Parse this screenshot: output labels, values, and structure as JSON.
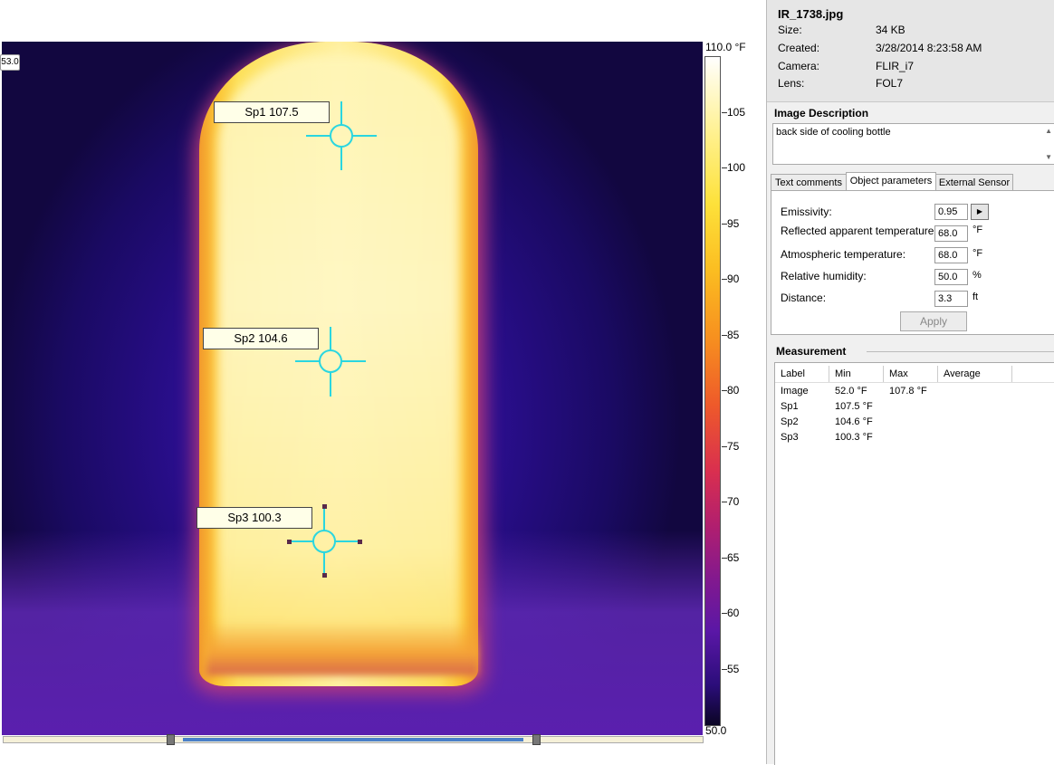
{
  "image": {
    "corner_value": "53.0",
    "spots": [
      {
        "label": "Sp1 107.5"
      },
      {
        "label": "Sp2 104.6"
      },
      {
        "label": "Sp3 100.3"
      }
    ]
  },
  "scale": {
    "max_label": "110.0 °F",
    "min_label": "50.0",
    "ticks": [
      "105",
      "100",
      "95",
      "90",
      "85",
      "80",
      "75",
      "70",
      "65",
      "60",
      "55"
    ]
  },
  "file_info": {
    "filename": "IR_1738.jpg",
    "rows": [
      {
        "label": "Size:",
        "value": "34 KB"
      },
      {
        "label": "Created:",
        "value": "3/28/2014 8:23:58 AM"
      },
      {
        "label": "Camera:",
        "value": "FLIR_i7"
      },
      {
        "label": "Lens:",
        "value": "FOL7"
      }
    ]
  },
  "description": {
    "heading": "Image Description",
    "text": "back side of cooling bottle"
  },
  "tabs": [
    {
      "label": "Text comments",
      "active": false
    },
    {
      "label": "Object parameters",
      "active": true
    },
    {
      "label": "External Sensor",
      "active": false
    }
  ],
  "params": [
    {
      "label": "Emissivity:",
      "value": "0.95",
      "unit": ""
    },
    {
      "label": "Reflected apparent temperature:",
      "value": "68.0",
      "unit": "°F"
    },
    {
      "label": "Atmospheric temperature:",
      "value": "68.0",
      "unit": "°F"
    },
    {
      "label": "Relative humidity:",
      "value": "50.0",
      "unit": "%"
    },
    {
      "label": "Distance:",
      "value": "3.3",
      "unit": "ft"
    }
  ],
  "apply_label": "Apply",
  "measurement": {
    "heading": "Measurement",
    "columns": [
      "Label",
      "Min",
      "Max",
      "Average"
    ],
    "rows": [
      {
        "label": "Image",
        "min": "52.0 °F",
        "max": "107.8 °F",
        "avg": ""
      },
      {
        "label": "Sp1",
        "min": "107.5 °F",
        "max": "",
        "avg": ""
      },
      {
        "label": "Sp2",
        "min": "104.6 °F",
        "max": "",
        "avg": ""
      },
      {
        "label": "Sp3",
        "min": "100.3 °F",
        "max": "",
        "avg": ""
      }
    ]
  },
  "colors": {
    "crosshair": "#2ad6e0",
    "selection_handle": "#5a2a4a"
  }
}
